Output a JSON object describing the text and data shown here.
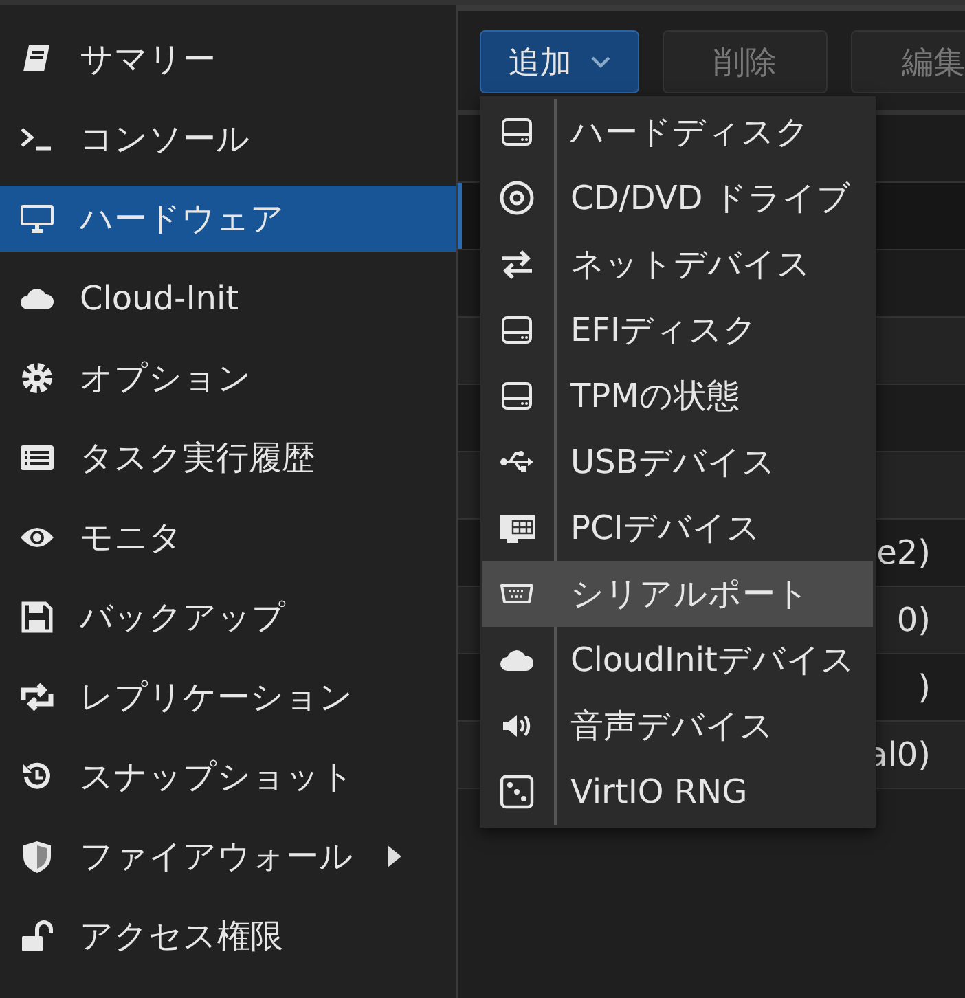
{
  "sidebar": {
    "items": [
      {
        "label": "サマリー",
        "selected": false,
        "submenu": false
      },
      {
        "label": "コンソール",
        "selected": false,
        "submenu": false
      },
      {
        "label": "ハードウェア",
        "selected": true,
        "submenu": false
      },
      {
        "label": "Cloud-Init",
        "selected": false,
        "submenu": false
      },
      {
        "label": "オプション",
        "selected": false,
        "submenu": false
      },
      {
        "label": "タスク実行履歴",
        "selected": false,
        "submenu": false
      },
      {
        "label": "モニタ",
        "selected": false,
        "submenu": false
      },
      {
        "label": "バックアップ",
        "selected": false,
        "submenu": false
      },
      {
        "label": "レプリケーション",
        "selected": false,
        "submenu": false
      },
      {
        "label": "スナップショット",
        "selected": false,
        "submenu": false
      },
      {
        "label": "ファイアウォール",
        "selected": false,
        "submenu": true
      },
      {
        "label": "アクセス権限",
        "selected": false,
        "submenu": false
      }
    ]
  },
  "toolbar": {
    "buttons": [
      {
        "label": "追加",
        "kind": "dropdown",
        "disabled": false
      },
      {
        "label": "削除",
        "kind": "plain",
        "disabled": true
      },
      {
        "label": "編集",
        "kind": "plain",
        "disabled": true
      }
    ]
  },
  "hardware_grid": {
    "rows": [
      {
        "selected": false
      },
      {
        "selected": true
      },
      {
        "selected": false
      },
      {
        "selected": false
      },
      {
        "selected": false
      },
      {
        "selected": false
      },
      {
        "selected": false,
        "value": "e2)"
      },
      {
        "selected": false,
        "value": "0)"
      },
      {
        "selected": false,
        "value": ")"
      },
      {
        "selected": false,
        "value": "al0)"
      }
    ]
  },
  "add_menu": {
    "items": [
      {
        "label": "ハードディスク",
        "selected": false
      },
      {
        "label": "CD/DVD ドライブ",
        "selected": false
      },
      {
        "label": "ネットデバイス",
        "selected": false
      },
      {
        "label": "EFIディスク",
        "selected": false
      },
      {
        "label": "TPMの状態",
        "selected": false
      },
      {
        "label": "USBデバイス",
        "selected": false
      },
      {
        "label": "PCIデバイス",
        "selected": false
      },
      {
        "label": "シリアルポート",
        "selected": true
      },
      {
        "label": "CloudInitデバイス",
        "selected": false
      },
      {
        "label": "音声デバイス",
        "selected": false
      },
      {
        "label": "VirtIO RNG",
        "selected": false
      }
    ]
  }
}
